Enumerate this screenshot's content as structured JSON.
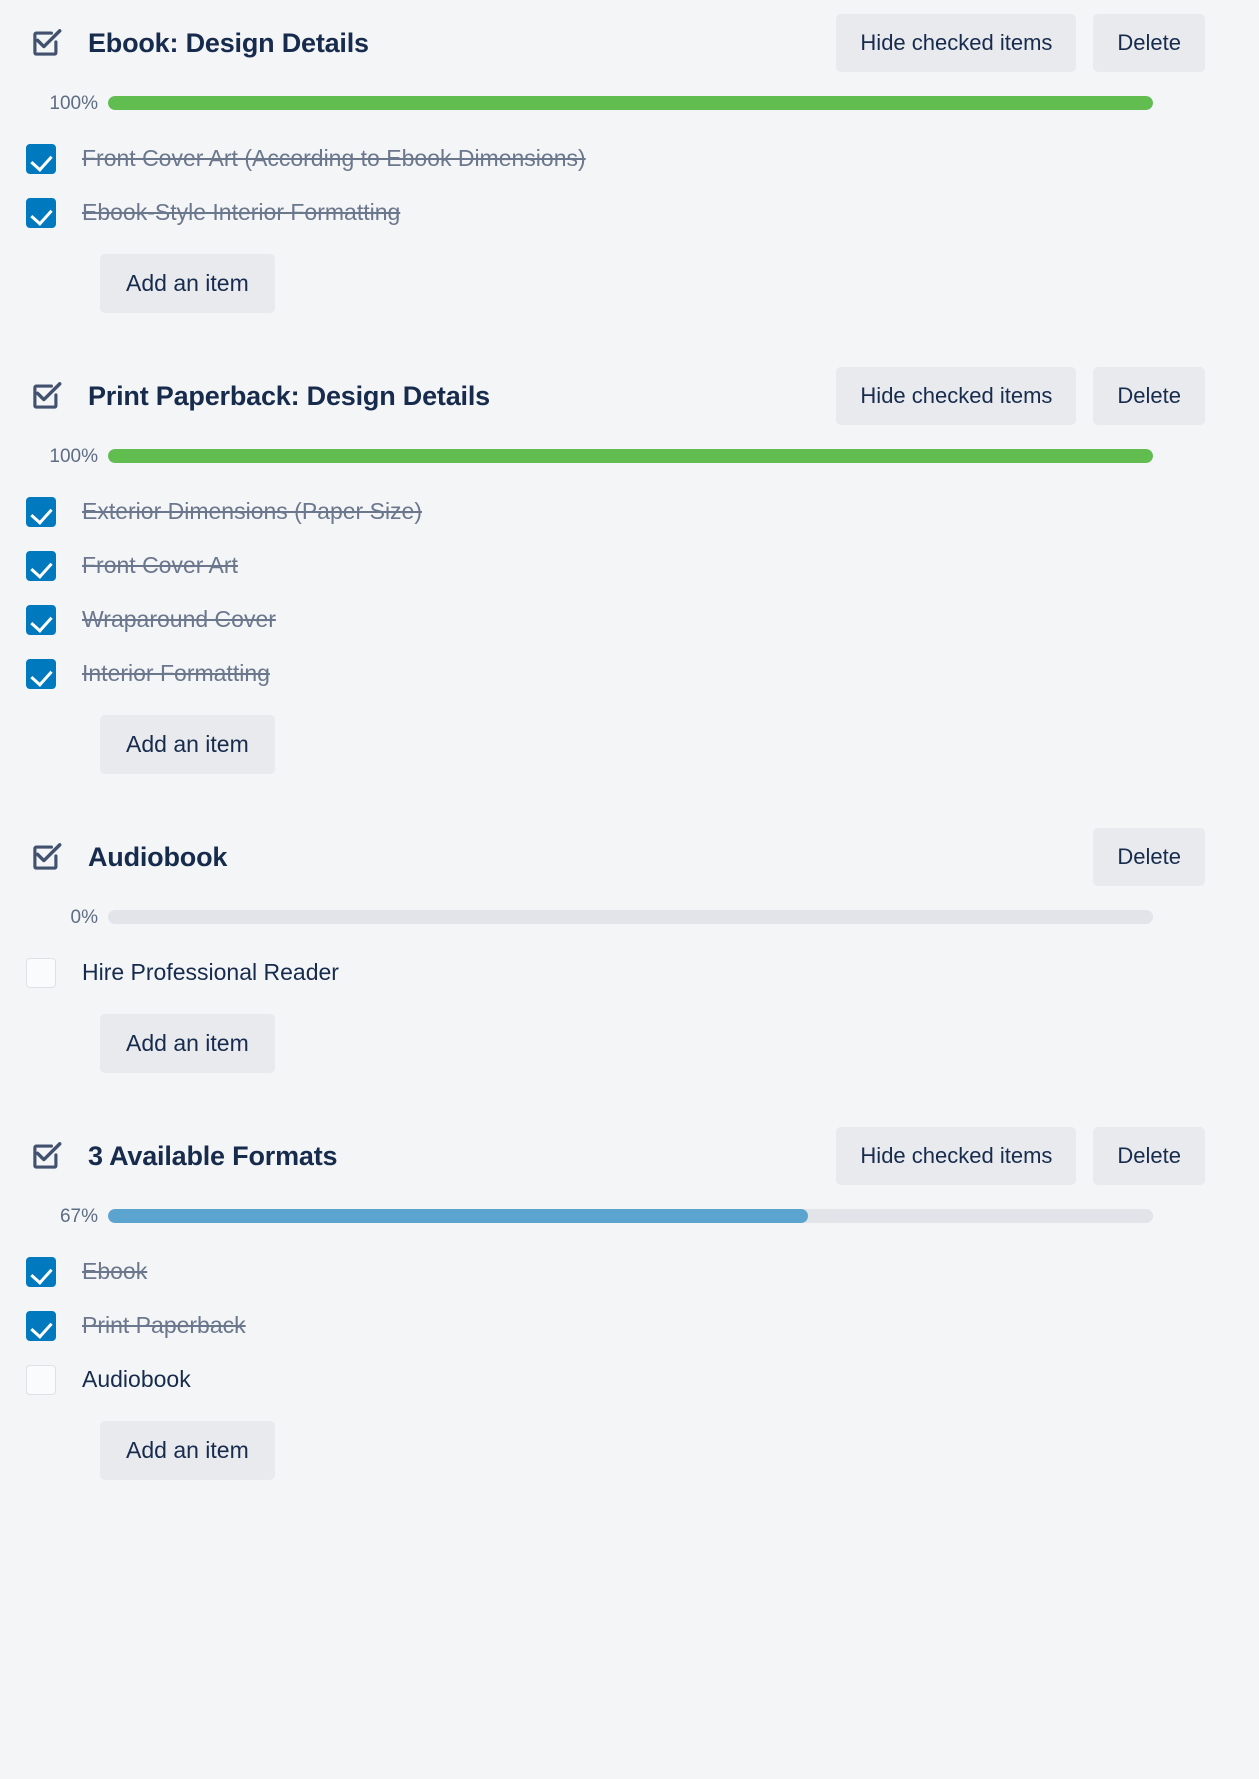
{
  "theme": {
    "background": "#f4f5f7",
    "text": "#172b4d",
    "muted": "#5e6c84",
    "checkbox_checked": "#0079bf",
    "progress_complete": "#61bd4f",
    "progress_partial": "#5ba4cf",
    "progress_track": "#e2e4e9",
    "button_bg": "#e9eaee"
  },
  "labels": {
    "hide_checked": "Hide checked items",
    "delete": "Delete",
    "add_item": "Add an item",
    "checklist_icon": "checklist-icon"
  },
  "checklists": [
    {
      "title": "Ebook: Design Details",
      "percent": "100%",
      "percent_value": 100,
      "bar_color": "#61bd4f",
      "has_hide_checked": true,
      "items": [
        {
          "label": "Front Cover Art (According to Ebook Dimensions)",
          "checked": true
        },
        {
          "label": "Ebook-Style Interior Formatting",
          "checked": true
        }
      ]
    },
    {
      "title": "Print Paperback: Design Details",
      "percent": "100%",
      "percent_value": 100,
      "bar_color": "#61bd4f",
      "has_hide_checked": true,
      "items": [
        {
          "label": "Exterior Dimensions (Paper Size)",
          "checked": true
        },
        {
          "label": "Front Cover Art",
          "checked": true
        },
        {
          "label": "Wraparound Cover",
          "checked": true
        },
        {
          "label": "Interior Formatting",
          "checked": true
        }
      ]
    },
    {
      "title": "Audiobook",
      "percent": "0%",
      "percent_value": 0,
      "bar_color": "#61bd4f",
      "has_hide_checked": false,
      "items": [
        {
          "label": "Hire Professional Reader",
          "checked": false
        }
      ]
    },
    {
      "title": "3 Available Formats",
      "percent": "67%",
      "percent_value": 67,
      "bar_color": "#5ba4cf",
      "has_hide_checked": true,
      "items": [
        {
          "label": "Ebook",
          "checked": true
        },
        {
          "label": "Print Paperback",
          "checked": true
        },
        {
          "label": "Audiobook",
          "checked": false
        }
      ]
    }
  ]
}
